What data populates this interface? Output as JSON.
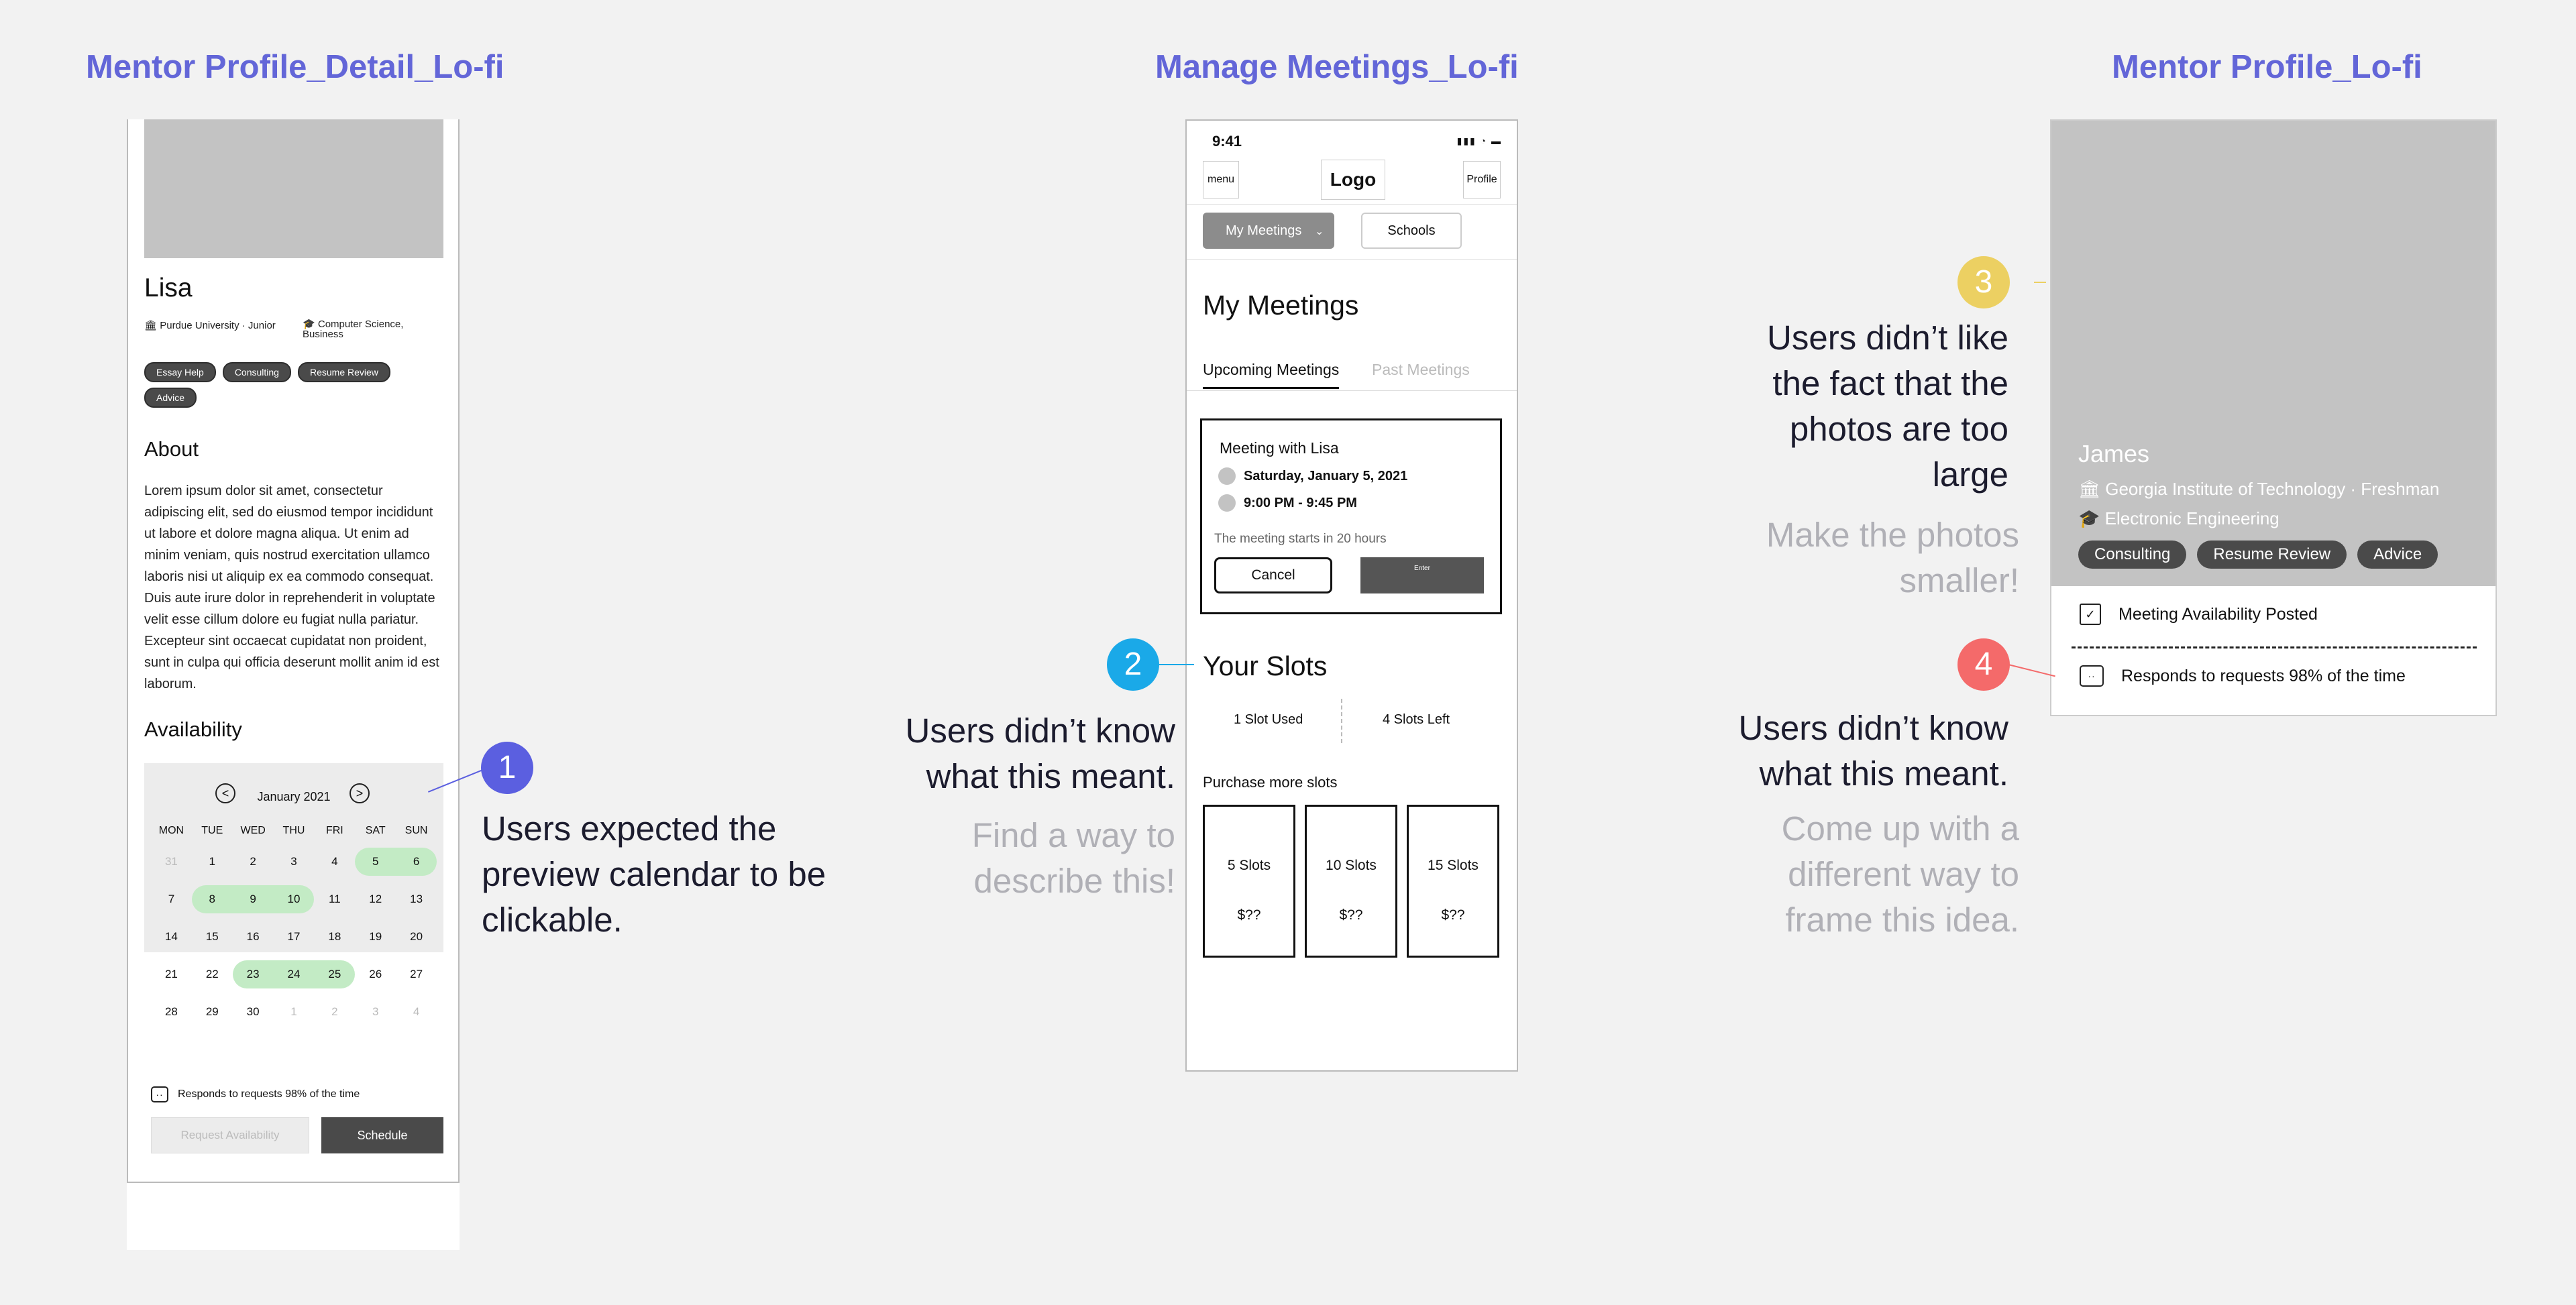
{
  "frames": {
    "detail_title": "Mentor Profile_Detail_Lo-fi",
    "meetings_title": "Manage Meetings_Lo-fi",
    "profile_title": "Mentor Profile_Lo-fi"
  },
  "detail": {
    "name": "Lisa",
    "school": "Purdue University · Junior",
    "major": "Computer Science, Business",
    "tags": [
      "Essay Help",
      "Consulting",
      "Resume Review",
      "Advice"
    ],
    "about_heading": "About",
    "about_text": "Lorem ipsum dolor sit amet, consectetur adipiscing elit, sed do eiusmod tempor incididunt ut labore et dolore magna aliqua. Ut enim ad minim veniam, quis nostrud exercitation ullamco laboris nisi ut aliquip ex ea commodo consequat. Duis aute irure dolor in reprehenderit in voluptate velit esse cillum dolore eu fugiat nulla pariatur. Excepteur sint occaecat cupidatat non proident, sunt in culpa qui officia deserunt mollit anim id est laborum.",
    "availability_heading": "Availability",
    "calendar": {
      "month": "January 2021",
      "prev": "<",
      "next": ">",
      "weekdays": [
        "MON",
        "TUE",
        "WED",
        "THU",
        "FRI",
        "SAT",
        "SUN"
      ],
      "weeks": [
        [
          "31",
          "1",
          "2",
          "3",
          "4",
          "5",
          "6"
        ],
        [
          "7",
          "8",
          "9",
          "10",
          "11",
          "12",
          "13"
        ],
        [
          "14",
          "15",
          "16",
          "17",
          "18",
          "19",
          "20"
        ],
        [
          "21",
          "22",
          "23",
          "24",
          "25",
          "26",
          "27"
        ],
        [
          "28",
          "29",
          "30",
          "1",
          "2",
          "3",
          "4"
        ]
      ]
    },
    "responds": "Responds to requests 98% of the time",
    "request_button": "Request Availability",
    "schedule_button": "Schedule"
  },
  "meetings": {
    "time": "9:41",
    "status_icons": "▮▮▮ ◔ ▬",
    "menu": "menu",
    "logo": "Logo",
    "profile": "Profile",
    "my_meetings_dropdown": "My Meetings",
    "schools_button": "Schools",
    "page_title": "My Meetings",
    "tabs": [
      "Upcoming Meetings",
      "Past Meetings"
    ],
    "card": {
      "title": "Meeting with Lisa",
      "date": "Saturday, January 5, 2021",
      "time": "9:00 PM - 9:45 PM",
      "starts": "The meeting starts in 20 hours",
      "cancel": "Cancel",
      "enter": "Enter"
    },
    "slots_title": "Your Slots",
    "slots_used": "1 Slot Used",
    "slots_left": "4 Slots Left",
    "purchase_title": "Purchase more slots",
    "packages": [
      {
        "name": "5 Slots",
        "price": "$??"
      },
      {
        "name": "10 Slots",
        "price": "$??"
      },
      {
        "name": "15 Slots",
        "price": "$??"
      }
    ]
  },
  "profile": {
    "name": "James",
    "school": "Georgia Institute of Technology · Freshman",
    "major": "Electronic Engineering",
    "tags": [
      "Consulting",
      "Resume Review",
      "Advice"
    ],
    "availability": "Meeting Availability Posted",
    "responds": "Responds to requests 98% of the time"
  },
  "annotations": [
    {
      "number": "1",
      "color": "#5b5fe0",
      "text": "Users expected the preview calendar to be clickable.",
      "suggestion": ""
    },
    {
      "number": "2",
      "color": "#1aa9e8",
      "text": "Users didn’t know what this meant.",
      "suggestion": "Find a way to describe this!"
    },
    {
      "number": "3",
      "color": "#ecd062",
      "text": "Users didn’t like the fact that the photos are too large",
      "suggestion": "Make the photos smaller!"
    },
    {
      "number": "4",
      "color": "#f46a6a",
      "text": "Users didn’t know what this meant.",
      "suggestion": "Come up with a different way to frame this idea."
    }
  ]
}
